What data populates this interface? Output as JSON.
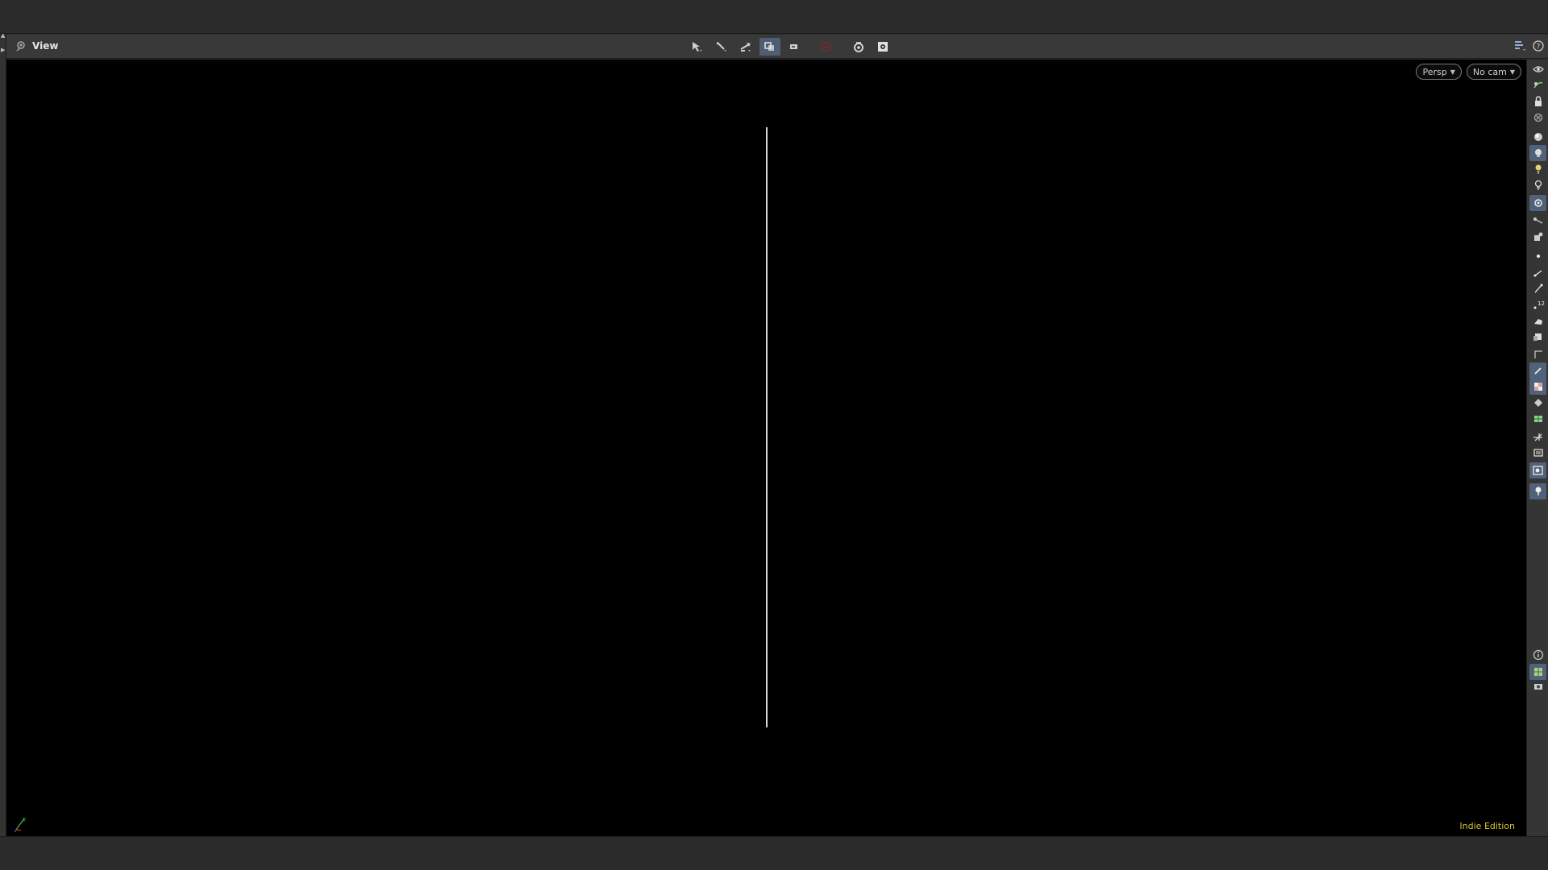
{
  "pane": {
    "title": "View",
    "camera_view": "Persp",
    "camera": "No cam",
    "edition_label": "Indie Edition"
  },
  "icons": {
    "pane_icon": "view-eye-icon",
    "toolbar": [
      "select-mode-icon",
      "secure-selection-icon",
      "handle-tool-icon",
      "ghost-display-icon",
      "snapshot-icon",
      "stop-icon",
      "render-camera-icon",
      "display-options-icon"
    ],
    "right_toolbar": [
      "visibility-icon",
      "lighting-icon",
      "lock-icon",
      "remove-icon",
      "shading-sphere-icon",
      "lit-shading-icon",
      "headlight-icon",
      "light-ball-icon",
      "camera-icon",
      "snap-icon",
      "tools-icon",
      "point-icon",
      "edge-icon",
      "normal-icon",
      "number-icon",
      "object-icon",
      "group-icon",
      "bounding-box-icon",
      "pin-icon",
      "checker-icon",
      "flat-icon",
      "uv-icon",
      "cut-icon",
      "layer-icon",
      "scene-icon",
      "pin-selected-icon",
      "info-icon",
      "grid-layout-icon",
      "eye-bottom-icon"
    ]
  },
  "colors": {
    "viewport_bg": "#000000",
    "accent_active": "#50627a",
    "edition_text": "#d7c230"
  }
}
